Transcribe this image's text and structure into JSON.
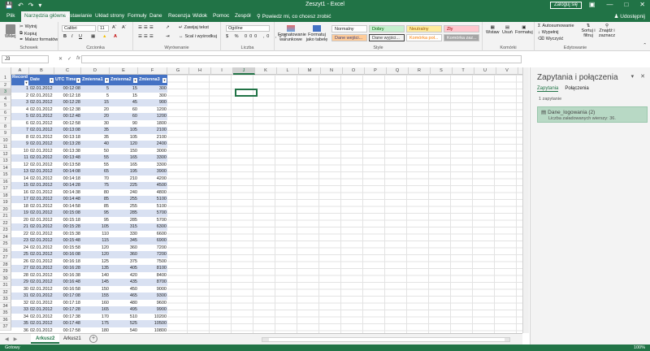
{
  "window": {
    "title": "Zeszyt1 - Excel",
    "login_label": "Zaloguj się"
  },
  "tabs": [
    "Plik",
    "Narzędzia główne",
    "Wstawianie",
    "Układ strony",
    "Formuły",
    "Dane",
    "Recenzja",
    "Widok",
    "Pomoc",
    "Zespół"
  ],
  "tell_me": "Powiedz mi, co chcesz zrobić",
  "share_label": "Udostępnij",
  "ribbon": {
    "clipboard": {
      "label": "Schowek",
      "paste": "Wklej",
      "cut": "Wytnij",
      "copy": "Kopiuj",
      "format_painter": "Malarz formatów"
    },
    "font": {
      "label": "Czcionka",
      "name": "Calibri",
      "size": "11",
      "bold": "B",
      "italic": "I",
      "underline": "U"
    },
    "alignment": {
      "label": "Wyrównanie",
      "wrap": "Zawijaj tekst",
      "merge": "Scal i wyśrodkuj"
    },
    "number": {
      "label": "Liczba",
      "format": "Ogólne"
    },
    "styles": {
      "label": "Style",
      "conditional": "Formatowanie warunkowe",
      "as_table": "Formatuj jako tabelę",
      "normal": "Normalny",
      "good": "Dobry",
      "neutral": "Neutralny",
      "bad": "Zły",
      "input": "Dane wejści...",
      "output": "Dane wyjści...",
      "linked": "Komórka poł...",
      "check": "Komórka zaz..."
    },
    "cells": {
      "label": "Komórki",
      "insert": "Wstaw",
      "delete": "Usuń",
      "format": "Formatuj"
    },
    "editing": {
      "label": "Edytowanie",
      "autosum": "Autosumowanie",
      "fill": "Wypełnij",
      "clear": "Wyczyść",
      "sort": "Sortuj i filtruj",
      "find": "Znajdź i zaznacz"
    }
  },
  "formula_bar": {
    "name_box": "J3",
    "value": ""
  },
  "columns": [
    "A",
    "B",
    "C",
    "D",
    "E",
    "F",
    "G",
    "H",
    "I",
    "J",
    "K",
    "L",
    "M",
    "N",
    "O",
    "P",
    "Q",
    "R",
    "S",
    "T",
    "U",
    "V",
    "W"
  ],
  "table": {
    "headers": [
      "Record",
      "Date",
      "UTC Time",
      "Zmienna1",
      "Zmienna2",
      "Zmienna3"
    ],
    "rows": [
      [
        "1",
        "02.01.2012",
        "00:12:08",
        "5",
        "15",
        "300"
      ],
      [
        "2",
        "02.01.2012",
        "00:12:18",
        "5",
        "15",
        "300"
      ],
      [
        "3",
        "02.01.2012",
        "00:12:28",
        "15",
        "45",
        "900"
      ],
      [
        "4",
        "02.01.2012",
        "00:12:38",
        "20",
        "60",
        "1200"
      ],
      [
        "5",
        "02.01.2012",
        "00:12:48",
        "20",
        "60",
        "1200"
      ],
      [
        "6",
        "02.01.2012",
        "00:12:58",
        "30",
        "90",
        "1800"
      ],
      [
        "7",
        "02.01.2012",
        "00:13:08",
        "35",
        "105",
        "2100"
      ],
      [
        "8",
        "02.01.2012",
        "00:13:18",
        "35",
        "105",
        "2100"
      ],
      [
        "9",
        "02.01.2012",
        "00:13:28",
        "40",
        "120",
        "2400"
      ],
      [
        "10",
        "02.01.2012",
        "00:13:38",
        "50",
        "150",
        "3000"
      ],
      [
        "11",
        "02.01.2012",
        "00:13:48",
        "55",
        "165",
        "3300"
      ],
      [
        "12",
        "02.01.2012",
        "00:13:58",
        "55",
        "165",
        "3300"
      ],
      [
        "13",
        "02.01.2012",
        "00:14:08",
        "65",
        "195",
        "3900"
      ],
      [
        "14",
        "02.01.2012",
        "00:14:18",
        "70",
        "210",
        "4200"
      ],
      [
        "15",
        "02.01.2012",
        "00:14:28",
        "75",
        "225",
        "4500"
      ],
      [
        "16",
        "02.01.2012",
        "00:14:38",
        "80",
        "240",
        "4800"
      ],
      [
        "17",
        "02.01.2012",
        "00:14:48",
        "85",
        "255",
        "5100"
      ],
      [
        "18",
        "02.01.2012",
        "00:14:58",
        "85",
        "255",
        "5100"
      ],
      [
        "19",
        "02.01.2012",
        "00:15:08",
        "95",
        "285",
        "5700"
      ],
      [
        "20",
        "02.01.2012",
        "00:15:18",
        "95",
        "285",
        "5700"
      ],
      [
        "21",
        "02.01.2012",
        "00:15:28",
        "105",
        "315",
        "6300"
      ],
      [
        "22",
        "02.01.2012",
        "00:15:38",
        "110",
        "330",
        "6600"
      ],
      [
        "23",
        "02.01.2012",
        "00:15:48",
        "115",
        "345",
        "6900"
      ],
      [
        "24",
        "02.01.2012",
        "00:15:58",
        "120",
        "360",
        "7200"
      ],
      [
        "25",
        "02.01.2012",
        "00:16:08",
        "120",
        "360",
        "7200"
      ],
      [
        "26",
        "02.01.2012",
        "00:16:18",
        "125",
        "375",
        "7500"
      ],
      [
        "27",
        "02.01.2012",
        "00:16:28",
        "135",
        "405",
        "8100"
      ],
      [
        "28",
        "02.01.2012",
        "00:16:38",
        "140",
        "420",
        "8400"
      ],
      [
        "29",
        "02.01.2012",
        "00:16:48",
        "145",
        "435",
        "8700"
      ],
      [
        "30",
        "02.01.2012",
        "00:16:58",
        "150",
        "450",
        "9000"
      ],
      [
        "31",
        "02.01.2012",
        "00:17:08",
        "155",
        "465",
        "9300"
      ],
      [
        "32",
        "02.01.2012",
        "00:17:18",
        "160",
        "480",
        "9600"
      ],
      [
        "33",
        "02.01.2012",
        "00:17:28",
        "165",
        "495",
        "9900"
      ],
      [
        "34",
        "02.01.2012",
        "00:17:38",
        "170",
        "510",
        "10200"
      ],
      [
        "35",
        "02.01.2012",
        "00:17:48",
        "175",
        "525",
        "10500"
      ],
      [
        "36",
        "02.01.2012",
        "00:17:58",
        "180",
        "540",
        "10800"
      ]
    ]
  },
  "sheets": [
    "Arkusz2",
    "Arkusz1"
  ],
  "pane": {
    "title": "Zapytania i połączenia",
    "tab_queries": "Zapytania",
    "tab_connections": "Połączenia",
    "count": "1 zapytanie",
    "query_name": "Dane_logowania (2)",
    "query_rows": "Liczba załadowanych wierszy: 36."
  },
  "status": {
    "ready": "Gotowy",
    "zoom": "100%"
  },
  "colors": {
    "accent": "#217346",
    "table_header": "#4472c4",
    "table_band": "#d9e1f2"
  }
}
